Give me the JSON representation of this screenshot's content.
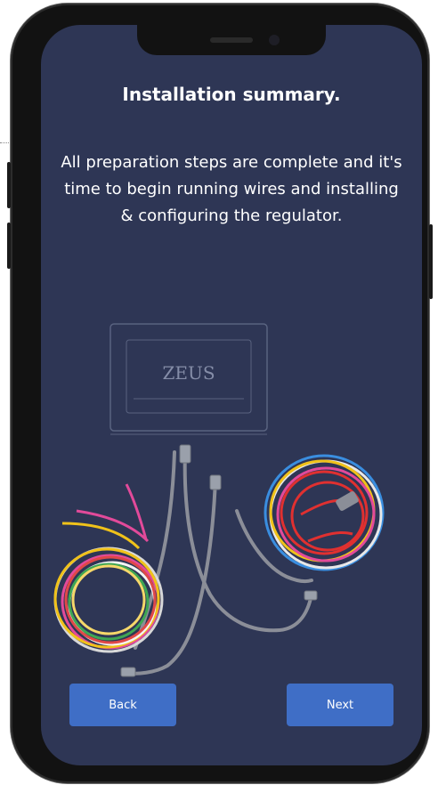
{
  "screen": {
    "title": "Installation summary.",
    "description": "All preparation steps are complete and it's time to begin running wires and installing & configuring the regulator.",
    "product_logo": "ZEUS"
  },
  "buttons": {
    "back_label": "Back",
    "next_label": "Next"
  },
  "colors": {
    "screen_background": "#2e3655",
    "button": "#3f6ec6",
    "text": "#ffffff"
  }
}
